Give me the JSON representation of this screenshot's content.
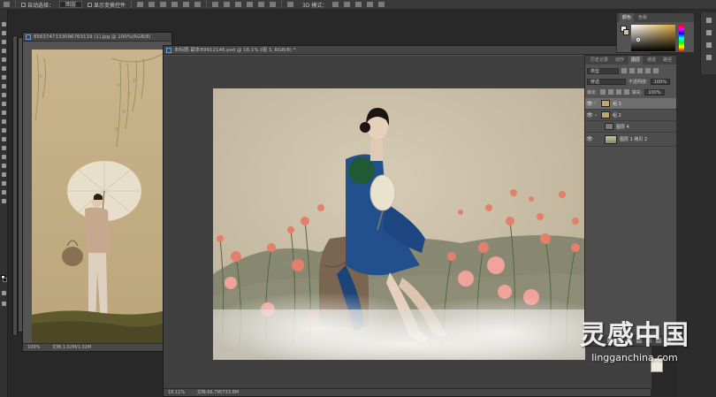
{
  "options_bar": {
    "auto_select_label": "自动选择：",
    "auto_select_value": "图层",
    "show_transform_label": "显示变换控件",
    "mode_3d_label": "3D 模式："
  },
  "doc_left": {
    "tab_title": "8563747133096763119 (1).jpg @ 100%(RGB/8)",
    "zoom": "100%",
    "file_info": "文档:1.02M/1.02M"
  },
  "doc_main": {
    "tab_title": "未标题-副本89912146.psd @ 18.1% (组 3, RGB/8) *",
    "zoom": "18.11%",
    "file_info": "文档:66.7M/733.8M"
  },
  "color_panel": {
    "tabs": [
      "颜色",
      "色板"
    ],
    "accent": "#d7a83a"
  },
  "layers_panel": {
    "tabs": [
      "历史记录",
      "动作",
      "图层",
      "通道",
      "路径"
    ],
    "active_tab": 2,
    "filter_kind": "类型",
    "blend_mode": "穿透",
    "opacity_label": "不透明度:",
    "opacity_value": "100%",
    "lock_label": "锁定:",
    "fill_label": "填充:",
    "fill_value": "100%",
    "layers": [
      {
        "name": "组 3",
        "type": "group",
        "visible": true,
        "selected": true
      },
      {
        "name": "组 2",
        "type": "group",
        "visible": true,
        "selected": false
      },
      {
        "name": "图层 4",
        "type": "layer",
        "visible": false,
        "selected": false
      },
      {
        "name": "图层 1 拷贝 2",
        "type": "layer",
        "visible": true,
        "selected": false
      }
    ]
  },
  "watermark": {
    "chinese": "灵感中国",
    "url": "lingganchina.com"
  }
}
